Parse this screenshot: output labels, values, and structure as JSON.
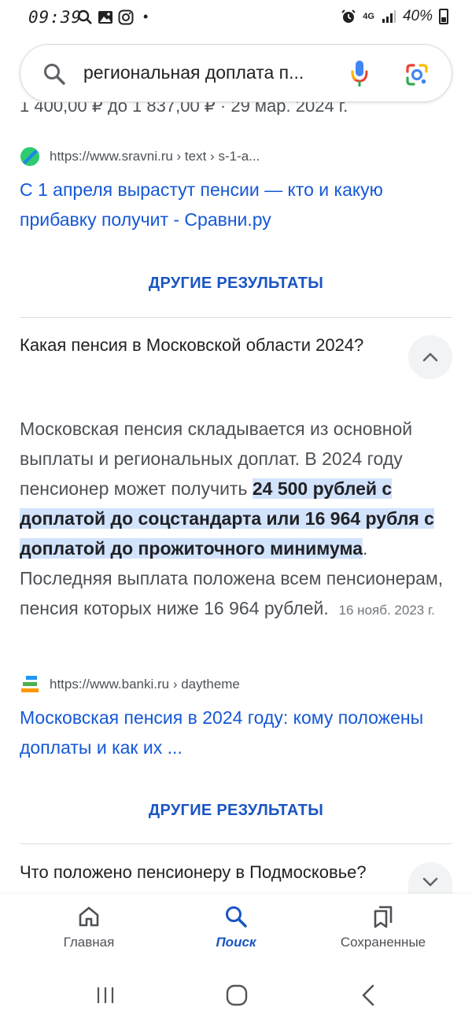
{
  "status_bar": {
    "time": "09:39",
    "dot": "•",
    "network": "4G",
    "battery": "40%"
  },
  "search": {
    "query": "региональная доплата п..."
  },
  "cut_text": "1 400,00 ₽ до 1 837,00 ₽ · 29 мар. 2024 г.",
  "results": [
    {
      "url": "https://www.sravni.ru › text › s-1-a...",
      "title": "С 1 апреля вырастут пенсии — кто и какую прибавку получит - Сравни.ру"
    },
    {
      "url": "https://www.banki.ru › daytheme",
      "title": "Московская пенсия в 2024 году: кому положены доплаты и как их ..."
    }
  ],
  "more_results_label": "ДРУГИЕ РЕЗУЛЬТАТЫ",
  "faq": [
    {
      "question": "Какая пенсия в Московской области 2024?",
      "answer_before": "Московская пенсия складывается из основной выплаты и региональных доплат. В 2024 году пенсионер может получить ",
      "answer_highlight": "24 500 рублей с доплатой до соцстандарта или 16 964 рубля с доплатой до прожиточного минимума",
      "answer_after": ". Последняя выплата положена всем пенсионерам, пенсия которых ниже 16 964 рублей.",
      "answer_date": "16 нояб. 2023 г."
    },
    {
      "question": "Что положено пенсионеру в Подмосковье?"
    }
  ],
  "bottom_nav": {
    "home": "Главная",
    "search": "Поиск",
    "saved": "Сохраненные"
  },
  "colors": {
    "link": "#1558d6",
    "accent": "#1a55c4",
    "highlight": "#d2e3fc"
  }
}
